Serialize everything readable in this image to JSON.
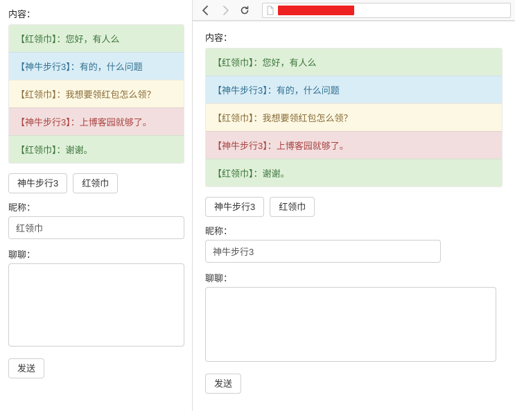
{
  "labels": {
    "content": "内容",
    "nickname": "昵称",
    "chat": "聊聊"
  },
  "buttons": {
    "user_a": "神牛步行3",
    "user_b": "红领巾",
    "send": "发送"
  },
  "left": {
    "nickname_value": "红领巾",
    "chat_value": ""
  },
  "right": {
    "nickname_value": "神牛步行3",
    "chat_value": "",
    "url_redact_width": 110
  },
  "messages": [
    {
      "variant": "green",
      "name": "红领巾",
      "text": "您好，有人么"
    },
    {
      "variant": "blue",
      "name": "神牛步行3",
      "text": "有的，什么问题"
    },
    {
      "variant": "yellow",
      "name": "红领巾",
      "text": "我想要领红包怎么领？"
    },
    {
      "variant": "red",
      "name": "神牛步行3",
      "text": "上博客园就够了。"
    },
    {
      "variant": "green",
      "name": "红领巾",
      "text": "谢谢。"
    }
  ]
}
